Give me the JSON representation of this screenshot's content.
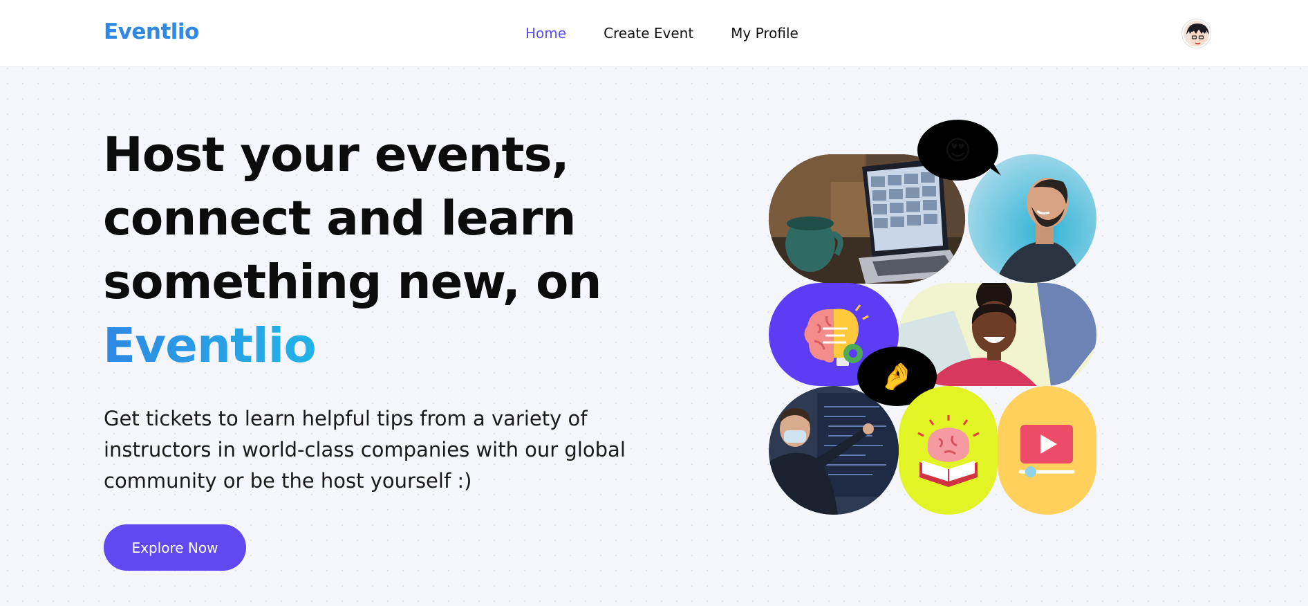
{
  "nav": {
    "brand": "Eventlio",
    "links": [
      {
        "label": "Home",
        "active": true
      },
      {
        "label": "Create Event",
        "active": false
      },
      {
        "label": "My Profile",
        "active": false
      }
    ],
    "avatar_icon": "user-avatar"
  },
  "hero": {
    "title_line1": "Host your events,",
    "title_line2": "connect and learn",
    "title_line3": "something new, on",
    "title_accent": "Eventlio",
    "subtitle": "Get tickets to learn helpful tips from a variety of instructors in world-class companies with our global community or be the host yourself :)",
    "cta_label": "Explore Now"
  },
  "collage": {
    "emoji_heart_eyes": "😍",
    "emoji_pinch": "🤌",
    "icons": [
      "laptop-video-call-photo",
      "man-smiling-photo",
      "brain-bulb-icon",
      "woman-laughing-photo",
      "presenter-photo",
      "brain-book-icon",
      "video-play-icon"
    ]
  },
  "colors": {
    "brand": "#2f88e4",
    "accent_purple": "#6149f2",
    "tile_purple": "#5c3cf5",
    "tile_lime": "#e2f425",
    "tile_yellow": "#ffd15c"
  }
}
